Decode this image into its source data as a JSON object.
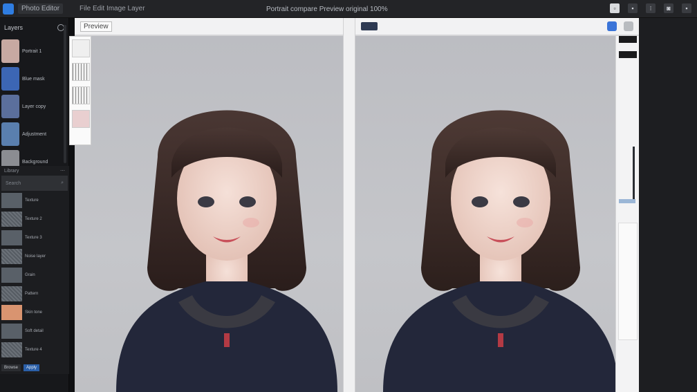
{
  "topbar": {
    "app_name": "Photo Editor",
    "menu": "File  Edit  Image  Layer",
    "doc_title": "Portrait compare  Preview  original 100%",
    "icons": [
      "window-icon",
      "minimize-icon",
      "settings-icon",
      "camera-icon",
      "close-icon"
    ]
  },
  "sidebar": {
    "header": "Layers",
    "layers": [
      {
        "label": "Portrait 1",
        "color": "#c7a9a2"
      },
      {
        "label": "Blue mask",
        "color": "#3c66b4"
      },
      {
        "label": "Layer copy",
        "color": "#5b6f9c"
      },
      {
        "label": "Adjustment",
        "color": "#5a7fae"
      },
      {
        "label": "Background",
        "color": "#8b8d92"
      }
    ]
  },
  "panel2": {
    "head_left": "Library",
    "bar_label": "Search",
    "rows": [
      {
        "label": "Texture",
        "kind": "plain"
      },
      {
        "label": "Texture 2",
        "kind": "tex"
      },
      {
        "label": "Texture 3",
        "kind": "plain"
      },
      {
        "label": "Noise layer",
        "kind": "tex"
      },
      {
        "label": "Grain",
        "kind": "plain"
      },
      {
        "label": "Pattern",
        "kind": "tex"
      },
      {
        "label": "Skin tone",
        "kind": "orange"
      },
      {
        "label": "Soft detail",
        "kind": "plain"
      },
      {
        "label": "Texture 4",
        "kind": "tex"
      }
    ],
    "footer_btn": "Browse",
    "footer_accent": "Apply"
  },
  "left_window": {
    "title": "Preview"
  },
  "colors": {
    "hair": "#3a2a26",
    "skin": "#f0d6cc",
    "lips": "#c8505a",
    "sweater": "#22263a",
    "accent": "#2f7de1"
  }
}
